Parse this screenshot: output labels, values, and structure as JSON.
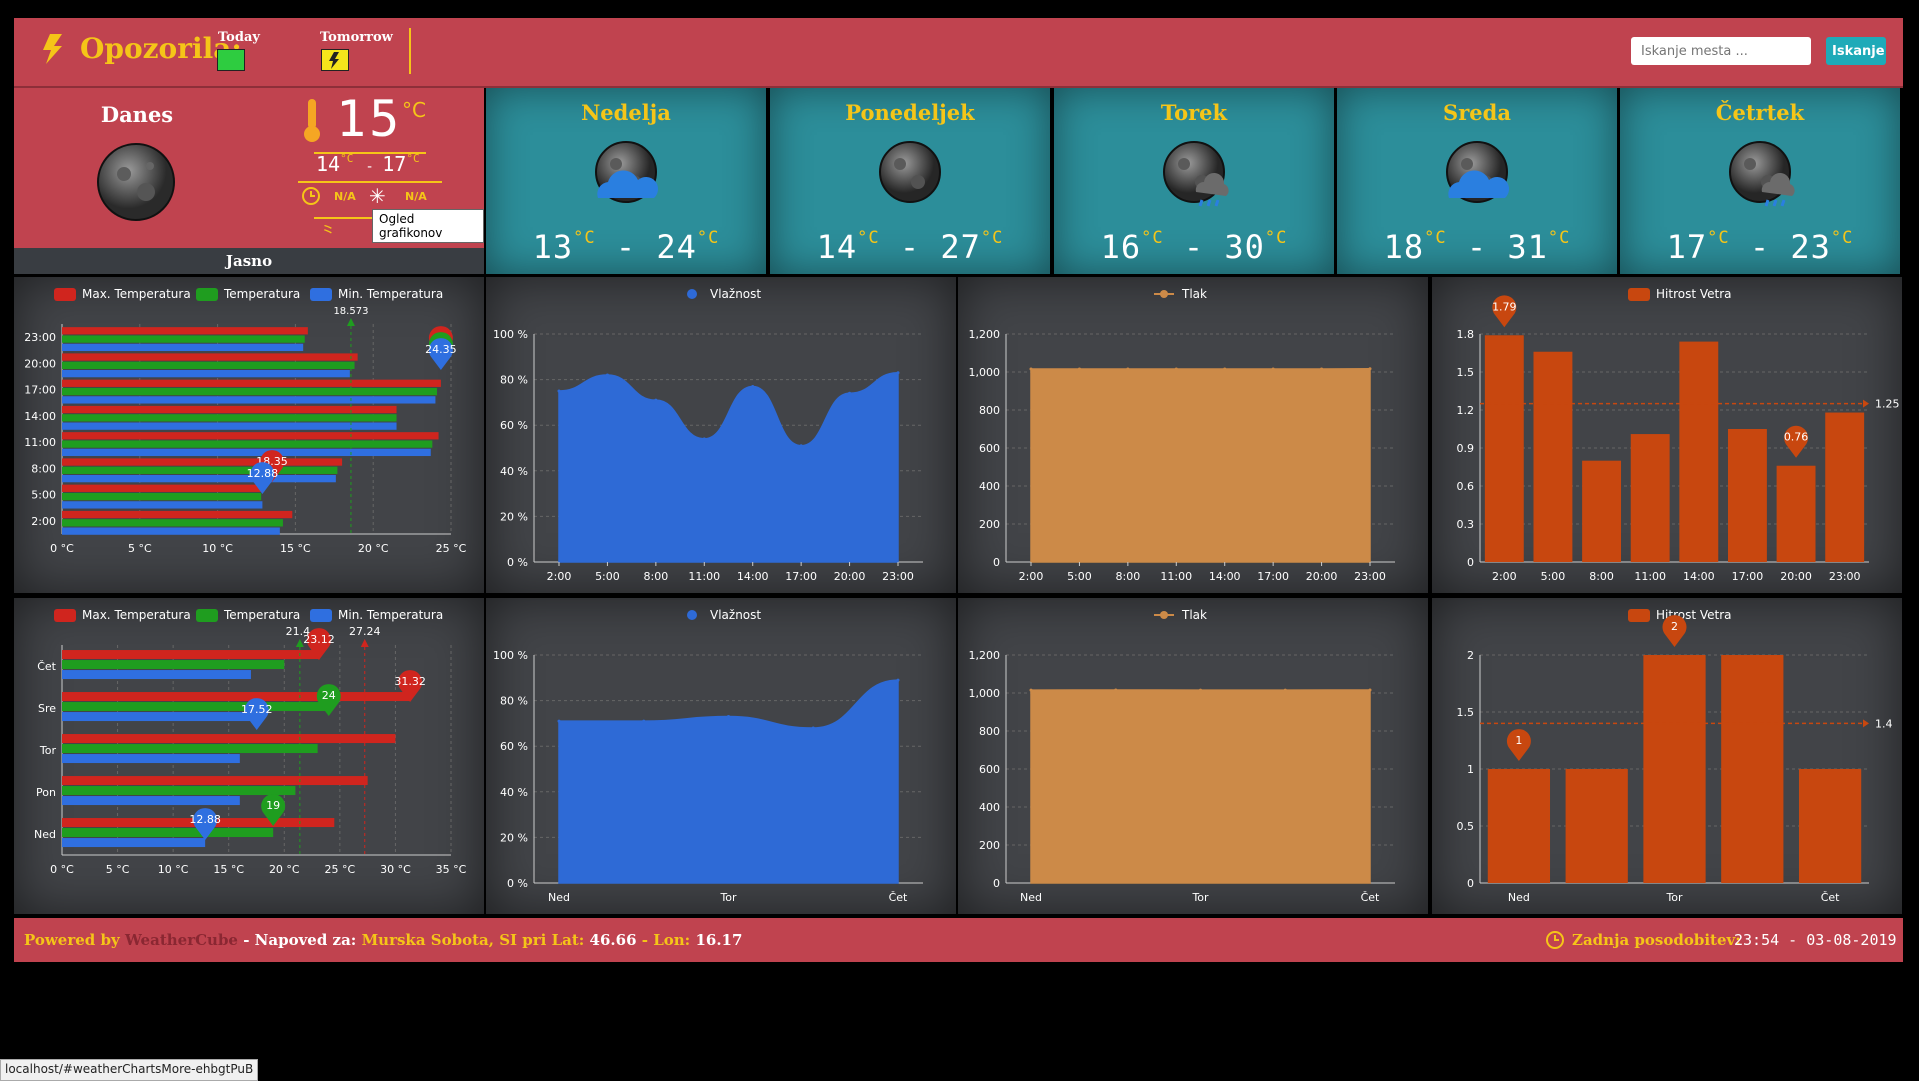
{
  "header": {
    "alerts_title": "Opozorila:",
    "today_label": "Today",
    "tomorrow_label": "Tomorrow",
    "today_color": "#2ecc40",
    "tomorrow_color": "#f5e51b",
    "search_placeholder": "Iskanje mesta ...",
    "search_button": "Iskanje"
  },
  "today": {
    "title": "Danes",
    "temp": "15",
    "unit": "°C",
    "range_low": "14",
    "range_high": "17",
    "sunrise": "N/A",
    "snow": "N/A",
    "tooltip": "Ogled grafikonov",
    "condition": "Jasno"
  },
  "forecast": [
    {
      "day": "Nedelja",
      "low": "13",
      "high": "24",
      "icon": "cloud-moon-icon"
    },
    {
      "day": "Ponedeljek",
      "low": "14",
      "high": "27",
      "icon": "moon-icon"
    },
    {
      "day": "Torek",
      "low": "16",
      "high": "30",
      "icon": "rain-moon-icon"
    },
    {
      "day": "Sreda",
      "low": "18",
      "high": "31",
      "icon": "cloud-moon-icon"
    },
    {
      "day": "Četrtek",
      "low": "17",
      "high": "23",
      "icon": "rain-moon-icon"
    }
  ],
  "legend": {
    "max_temp": "Max. Temperatura",
    "temp": "Temperatura",
    "min_temp": "Min. Temperatura",
    "humidity": "Vlažnost",
    "pressure": "Tlak",
    "wind": "Hitrost Vetra"
  },
  "colors": {
    "red": "#d0251e",
    "green": "#1f9d1f",
    "blue": "#2f6fe0",
    "area_blue": "#2e6ad6",
    "orange": "#cc8a48",
    "bar_orange": "#c8470f"
  },
  "chart_data": [
    {
      "type": "bar",
      "orientation": "horizontal",
      "categories": [
        "2:00",
        "5:00",
        "8:00",
        "11:00",
        "14:00",
        "17:00",
        "20:00",
        "23:00"
      ],
      "series": [
        {
          "name": "Max. Temperatura",
          "values": [
            14.8,
            13.0,
            18.0,
            24.2,
            21.5,
            24.35,
            19.0,
            15.8
          ]
        },
        {
          "name": "Temperatura",
          "values": [
            14.2,
            12.8,
            17.7,
            23.8,
            21.5,
            24.1,
            18.8,
            15.6
          ]
        },
        {
          "name": "Min. Temperatura",
          "values": [
            14.0,
            12.88,
            17.6,
            23.7,
            21.5,
            24.0,
            18.5,
            15.5
          ]
        }
      ],
      "xlim": [
        0,
        25
      ],
      "xticks": [
        "0 °C",
        "5 °C",
        "10 °C",
        "15 °C",
        "20 °C",
        "25 °C"
      ],
      "markers": [
        "24.35",
        "12.88",
        "18.35"
      ],
      "markline_label": "18.573"
    },
    {
      "type": "area",
      "categories": [
        "2:00",
        "5:00",
        "8:00",
        "11:00",
        "14:00",
        "17:00",
        "20:00",
        "23:00"
      ],
      "series": [
        {
          "name": "Vlažnost",
          "values": [
            75,
            82,
            71,
            54,
            77,
            51,
            74,
            83
          ]
        }
      ],
      "ylim": [
        0,
        100
      ],
      "yticks": [
        "0 %",
        "20 %",
        "40 %",
        "60 %",
        "80 %",
        "100 %"
      ]
    },
    {
      "type": "area",
      "categories": [
        "2:00",
        "5:00",
        "8:00",
        "11:00",
        "14:00",
        "17:00",
        "20:00",
        "23:00"
      ],
      "series": [
        {
          "name": "Tlak",
          "values": [
            1016,
            1016,
            1016,
            1016,
            1016,
            1016,
            1016,
            1017
          ]
        }
      ],
      "ylim": [
        0,
        1200
      ],
      "yticks": [
        "0",
        "200",
        "400",
        "600",
        "800",
        "1,000",
        "1,200"
      ]
    },
    {
      "type": "bar",
      "categories": [
        "2:00",
        "5:00",
        "8:00",
        "11:00",
        "14:00",
        "17:00",
        "20:00",
        "23:00"
      ],
      "series": [
        {
          "name": "Hitrost Vetra",
          "values": [
            1.79,
            1.66,
            0.8,
            1.01,
            1.74,
            1.05,
            0.76,
            1.18
          ]
        }
      ],
      "ylim": [
        0,
        1.8
      ],
      "yticks": [
        "0",
        "0.3",
        "0.6",
        "0.9",
        "1.2",
        "1.5",
        "1.8"
      ],
      "max_label": "1.79",
      "min_label": "0.76",
      "avg_label": "1.25",
      "avg": 1.25
    },
    {
      "type": "bar",
      "orientation": "horizontal",
      "categories": [
        "Ned",
        "Pon",
        "Tor",
        "Sre",
        "Čet"
      ],
      "series": [
        {
          "name": "Max. Temperatura",
          "values": [
            24.5,
            27.5,
            30.0,
            31.32,
            23.12
          ]
        },
        {
          "name": "Temperatura",
          "values": [
            19.0,
            21.0,
            23.0,
            24.0,
            20.0
          ]
        },
        {
          "name": "Min. Temperatura",
          "values": [
            12.88,
            16.0,
            16.0,
            17.52,
            17.0
          ]
        }
      ],
      "xlim": [
        0,
        35
      ],
      "xticks": [
        "0 °C",
        "5 °C",
        "10 °C",
        "15 °C",
        "20 °C",
        "25 °C",
        "30 °C",
        "35 °C"
      ],
      "markers": [
        "31.32",
        "23.12",
        "24",
        "19",
        "17.52",
        "12.88"
      ],
      "markline_labels": [
        "21.4",
        "27.24"
      ]
    },
    {
      "type": "area",
      "categories": [
        "Ned",
        "Tor",
        "Čet"
      ],
      "x": [
        0,
        1,
        2,
        3,
        4
      ],
      "series": [
        {
          "name": "Vlažnost",
          "values": [
            71,
            71,
            73,
            68,
            89
          ]
        }
      ],
      "ylim": [
        0,
        100
      ],
      "yticks": [
        "0 %",
        "20 %",
        "40 %",
        "60 %",
        "80 %",
        "100 %"
      ]
    },
    {
      "type": "area",
      "categories": [
        "Ned",
        "Tor",
        "Čet"
      ],
      "x": [
        0,
        1,
        2,
        3,
        4
      ],
      "series": [
        {
          "name": "Tlak",
          "values": [
            1015,
            1016,
            1015,
            1015,
            1016
          ]
        }
      ],
      "ylim": [
        0,
        1200
      ],
      "yticks": [
        "0",
        "200",
        "400",
        "600",
        "800",
        "1,000",
        "1,200"
      ]
    },
    {
      "type": "bar",
      "categories": [
        "Ned",
        "",
        "Tor",
        "",
        "Čet"
      ],
      "series": [
        {
          "name": "Hitrost Vetra",
          "values": [
            1,
            1,
            2,
            2,
            1
          ]
        }
      ],
      "ylim": [
        0,
        2
      ],
      "yticks": [
        "0",
        "0.5",
        "1",
        "1.5",
        "2"
      ],
      "max_label": "2",
      "min_label": "1",
      "avg_label": "1.4",
      "avg": 1.4
    }
  ],
  "footer": {
    "powered_by": "Powered by",
    "brand": "WeatherCube",
    "forecast_for": "- Napoved za:",
    "location": "Murska Sobota, SI pri Lat:",
    "lat": "46.66",
    "lon_label": "- Lon:",
    "lon": "16.17",
    "updated_label": "Zadnja posodobitev:",
    "updated_value": "23:54 - 03-08-2019"
  },
  "status_url": "localhost/#weatherChartsMore-ehbgtPuB"
}
